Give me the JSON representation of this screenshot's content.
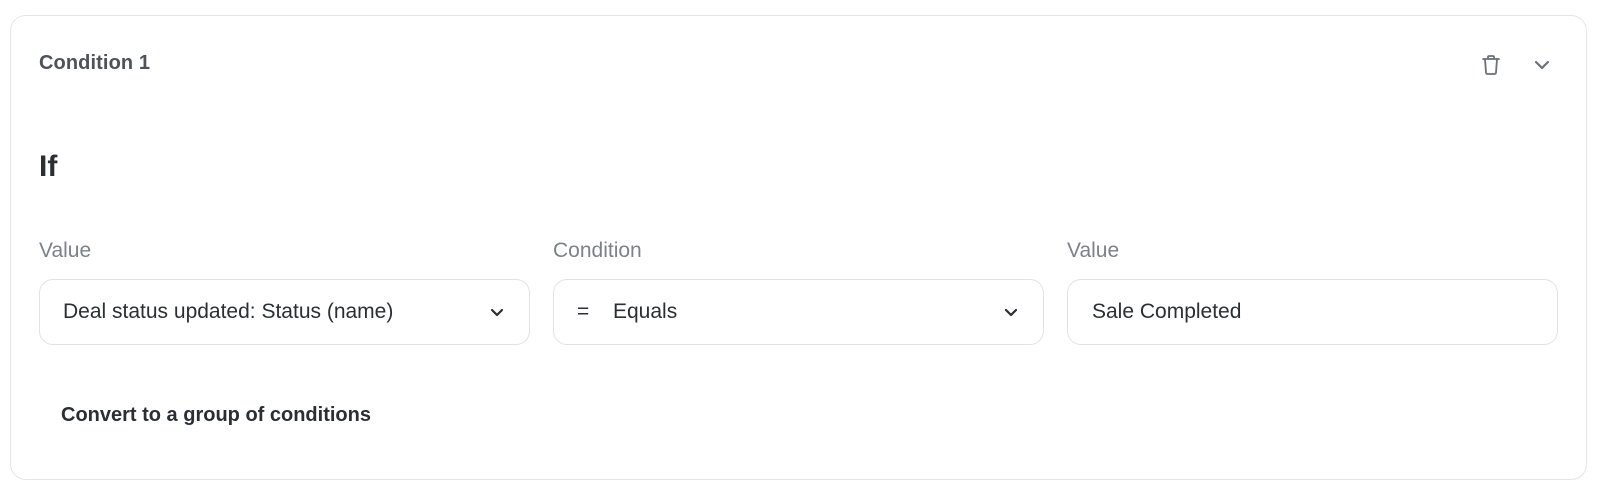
{
  "condition": {
    "title": "Condition 1",
    "icons": {
      "delete": "trash-icon",
      "collapse": "chevron-down-icon"
    },
    "if_heading": "If",
    "fields": {
      "left_value": {
        "label": "Value",
        "selected": "Deal status updated: Status (name)"
      },
      "operator": {
        "label": "Condition",
        "symbol": "=",
        "selected": "Equals"
      },
      "right_value": {
        "label": "Value",
        "value": "Sale Completed"
      }
    },
    "convert_link": "Convert to a group of conditions"
  },
  "colors": {
    "border": "#dfe2e6",
    "label": "#7c8288",
    "text": "#2b2f33",
    "title": "#4d5358",
    "icon": "#6b7178"
  }
}
